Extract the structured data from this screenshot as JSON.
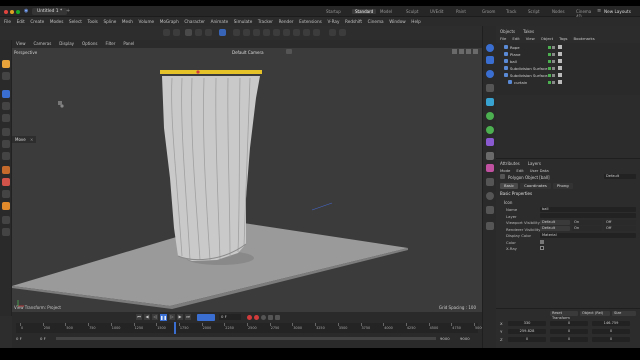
{
  "title_bar": {
    "document_tab": "Untitled 1 *",
    "layout_tabs": [
      "Startup",
      "Standard",
      "Model",
      "Sculpt",
      "UVEdit",
      "Paint",
      "Groom",
      "Track",
      "Script",
      "Nodes",
      "Cinema 4D"
    ],
    "active_layout": "Standard",
    "new_layouts": "New Layouts"
  },
  "menu": [
    "File",
    "Edit",
    "Create",
    "Modes",
    "Select",
    "Tools",
    "Spline",
    "Mesh",
    "Volume",
    "MoGraph",
    "Character",
    "Animate",
    "Simulate",
    "Tracker",
    "Render",
    "Extensions",
    "V-Ray",
    "Redshift",
    "Cinema",
    "Window",
    "Help"
  ],
  "viewport": {
    "menu": [
      "View",
      "Cameras",
      "Display",
      "Options",
      "Filter",
      "Panel"
    ],
    "projection": "Perspective",
    "camera": "Default Camera",
    "transform_label": "View Transform: Project",
    "grid_spacing": "Grid Spacing : 100",
    "move_tooltip": "Move"
  },
  "timeline": {
    "current_frame": "0 F",
    "current_frame_right": "0 F",
    "end_frame": "9000",
    "end_frame_right": "9000",
    "fps_field": "0 F",
    "ticks": [
      "0",
      "250",
      "500",
      "750",
      "1000",
      "1250",
      "1500",
      "1750",
      "2000",
      "2250",
      "2500",
      "2750",
      "3000",
      "3250",
      "3500",
      "3750",
      "4000",
      "4250",
      "4500",
      "4750",
      "5000"
    ]
  },
  "objects_panel": {
    "tabs": [
      "Objects",
      "Takes"
    ],
    "menu": [
      "File",
      "Edit",
      "View",
      "Object",
      "Tags",
      "Bookmarks"
    ],
    "items": [
      {
        "name": "Rope",
        "indent": 1
      },
      {
        "name": "Plane",
        "indent": 1
      },
      {
        "name": "ball",
        "indent": 1
      },
      {
        "name": "Subdivision Surface",
        "indent": 1
      },
      {
        "name": "Subdivision Surface.1",
        "indent": 1
      },
      {
        "name": "curtain",
        "indent": 2
      }
    ]
  },
  "attributes_panel": {
    "tabs": [
      "Attributes",
      "Layers"
    ],
    "menu": [
      "Mode",
      "Edit",
      "User Data"
    ],
    "object_label": "Polygon Object [ball]",
    "preset": "Default",
    "subtabs": [
      "Basic",
      "Coordinates",
      "Phong"
    ],
    "section": "Basic Properties",
    "subsection": "Icon",
    "fields": [
      {
        "label": "Name",
        "value": "ball"
      },
      {
        "label": "Layer",
        "value": ""
      },
      {
        "label": "Viewport Visibility",
        "value": "Default",
        "on": "On",
        "off": "Off"
      },
      {
        "label": "Renderer Visibility",
        "value": "Default",
        "on": "On",
        "off": "Off"
      },
      {
        "label": "Display Color",
        "value": "Material"
      },
      {
        "label": "Color",
        "value": ""
      },
      {
        "label": "X-Ray",
        "value": ""
      }
    ]
  },
  "coordinates": {
    "headers": [
      "Reset Transform",
      "Object (Rel)",
      "Size"
    ],
    "rows": [
      [
        "X",
        "330",
        "0",
        "146.759"
      ],
      [
        "Y",
        "259.828",
        "0",
        "0"
      ],
      [
        "Z",
        "0",
        "0",
        "0"
      ]
    ]
  },
  "colors": {
    "accent": "#3a6fd1",
    "curtain_bar": "#e6c229",
    "rec": "#d23b3b"
  }
}
